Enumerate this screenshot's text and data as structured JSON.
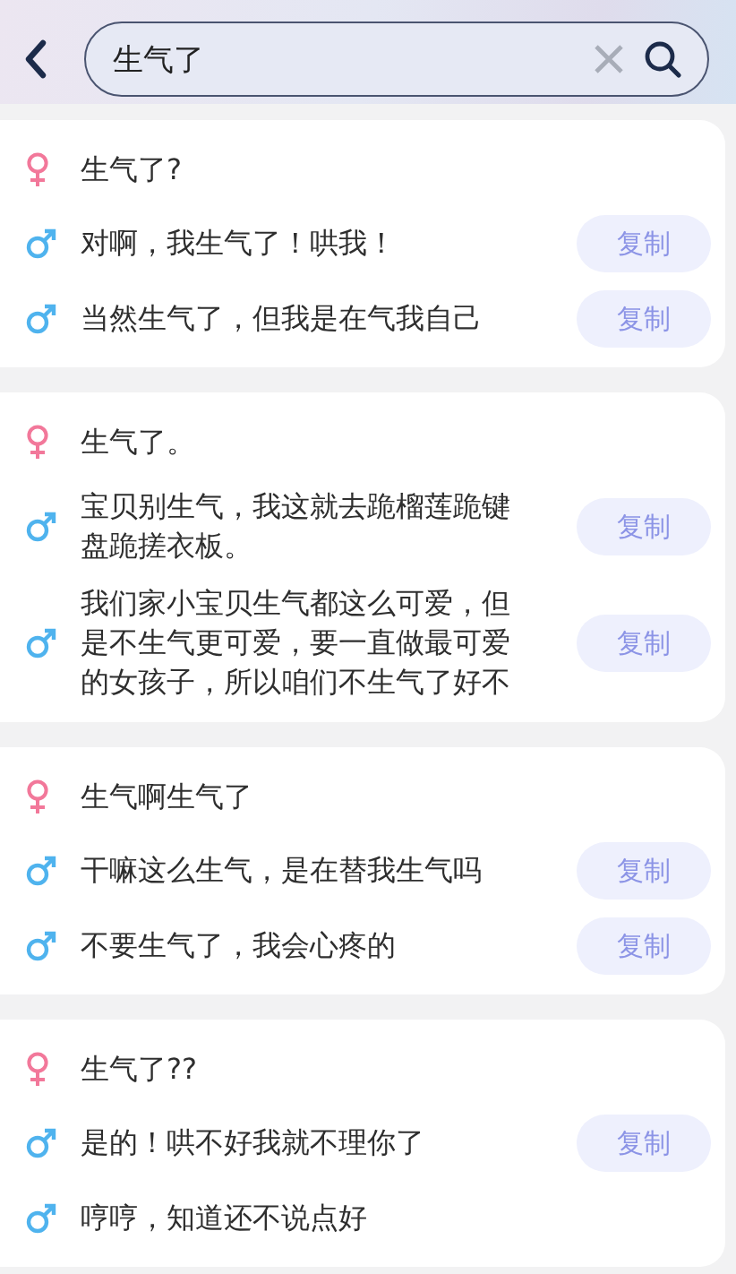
{
  "search": {
    "value": "生气了"
  },
  "groups": [
    {
      "messages": [
        {
          "kind": "female",
          "text": "生气了?"
        },
        {
          "kind": "male",
          "text": "对啊，我生气了！哄我！",
          "action": "复制"
        },
        {
          "kind": "male",
          "text": "当然生气了，但我是在气我自己",
          "action": "复制"
        }
      ]
    },
    {
      "messages": [
        {
          "kind": "female",
          "text": "生气了。"
        },
        {
          "kind": "male",
          "text": "宝贝别生气，我这就去跪榴莲跪键盘跪搓衣板。",
          "action": "复制"
        },
        {
          "kind": "male",
          "text": "我们家小宝贝生气都这么可爱，但是不生气更可爱，要一直做最可爱的女孩子，所以咱们不生气了好不",
          "action": "复制"
        }
      ]
    },
    {
      "messages": [
        {
          "kind": "female",
          "text": "生气啊生气了"
        },
        {
          "kind": "male",
          "text": "干嘛这么生气，是在替我生气吗",
          "action": "复制"
        },
        {
          "kind": "male",
          "text": "不要生气了，我会心疼的",
          "action": "复制"
        }
      ]
    },
    {
      "messages": [
        {
          "kind": "female",
          "text": "生气了??"
        },
        {
          "kind": "male",
          "text": "是的！哄不好我就不理你了",
          "action": "复制"
        },
        {
          "kind": "male",
          "text": "哼哼，知道还不说点好"
        }
      ]
    }
  ]
}
